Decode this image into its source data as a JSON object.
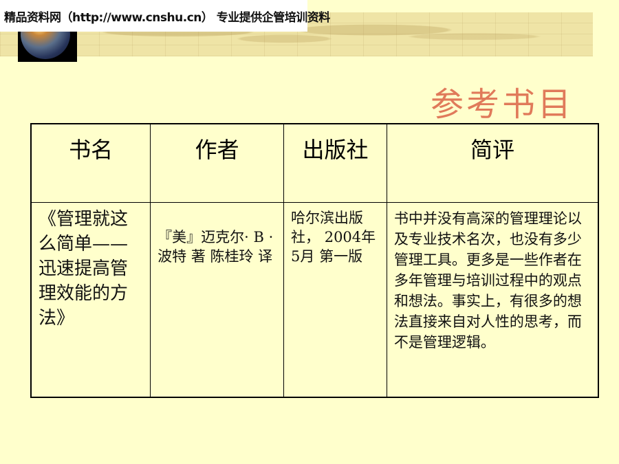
{
  "watermark": {
    "text": "精品资料网（http://www.cnshu.cn） 专业提供企管培训资料"
  },
  "slide": {
    "title": "参考书目"
  },
  "table": {
    "headers": [
      "书名",
      "作者",
      "出版社",
      "简评"
    ],
    "rows": [
      {
        "title": "《管理就这么简单——迅速提高管理效能的方法》",
        "author": "『美』迈克尔· B ·波特 著 陈桂玲 译",
        "publisher": "哈尔滨出版社， 2004年5月 第一版",
        "review": "书中并没有高深的管理理论以及专业技术名次，也没有多少管理工具。更多是一些作者在多年管理与培训过程中的观点和想法。事实上，有很多的想法直接来自对人性的思考，而不是管理逻辑。"
      }
    ]
  },
  "colors": {
    "background": "#ffffcc",
    "title": "#e07a5a"
  },
  "icons": [
    "globe-icon"
  ]
}
